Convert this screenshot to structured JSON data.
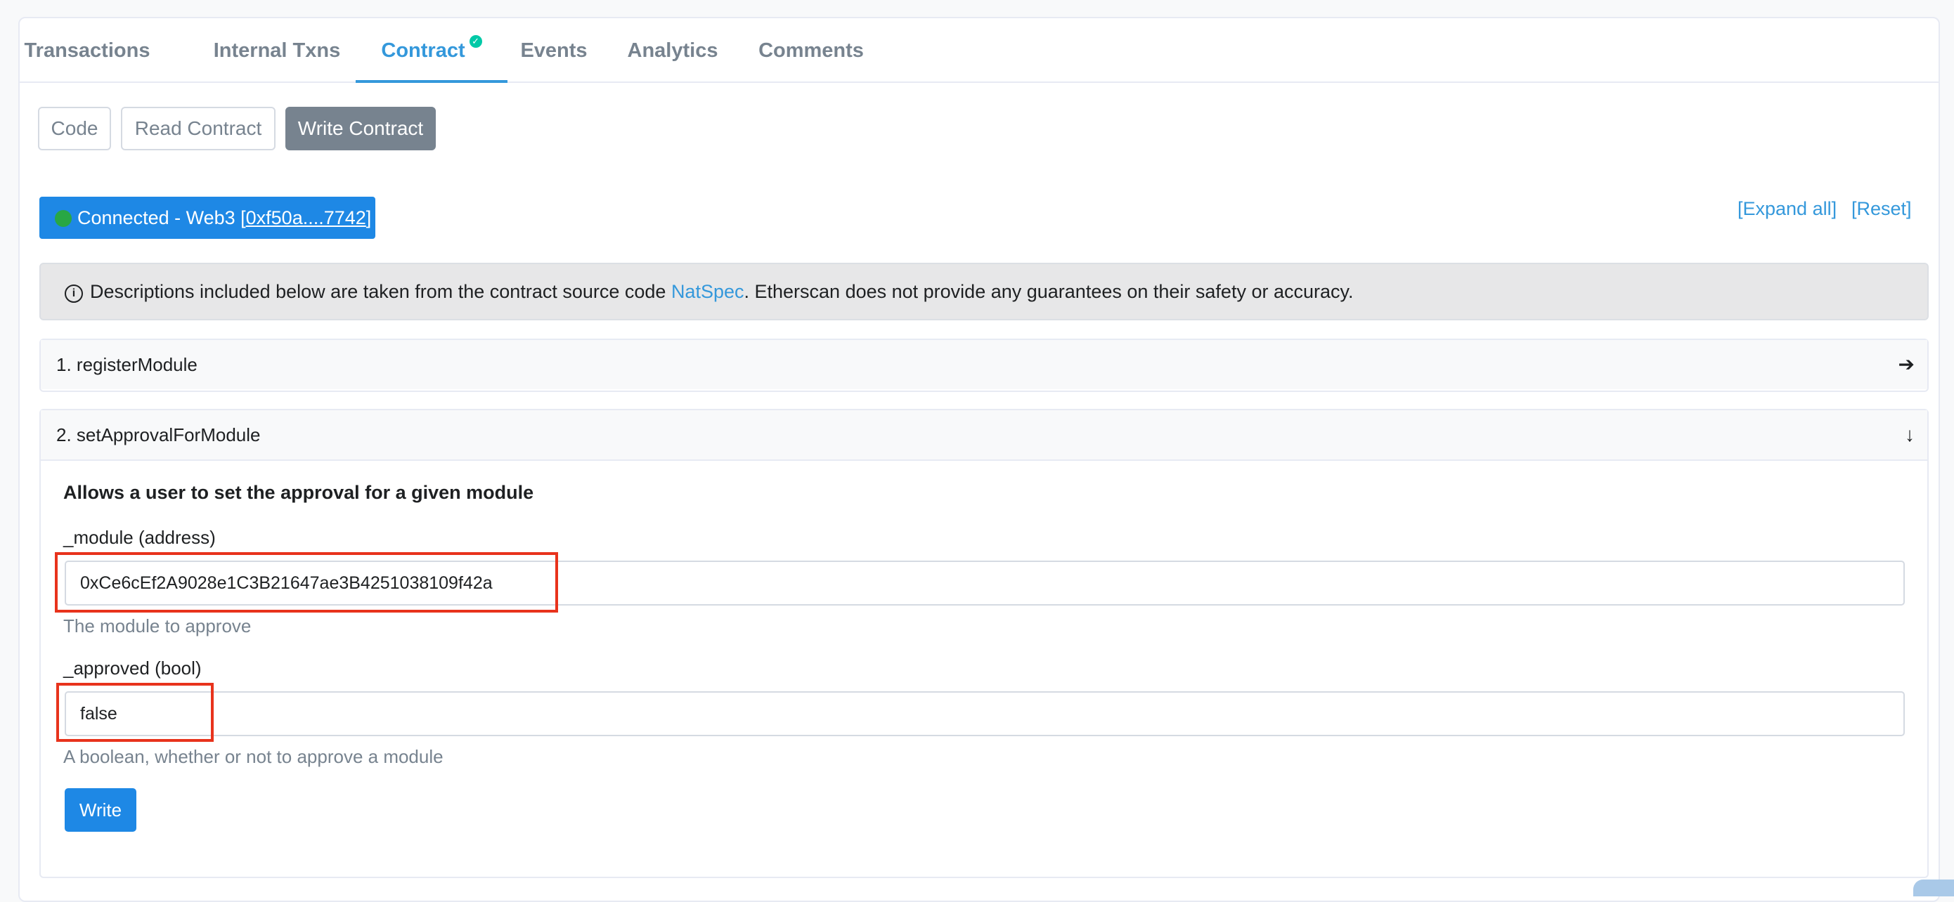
{
  "tabs": [
    {
      "label": "Transactions"
    },
    {
      "label": "Internal Txns"
    },
    {
      "label": "Contract"
    },
    {
      "label": "Events"
    },
    {
      "label": "Analytics"
    },
    {
      "label": "Comments"
    }
  ],
  "subtabs": {
    "code": "Code",
    "read": "Read Contract",
    "write": "Write Contract"
  },
  "connection": {
    "status": "Connected - Web3 [",
    "address": "0xf50a....7742",
    "close": "]"
  },
  "links": {
    "expand_all": "[Expand all]",
    "reset": "[Reset]"
  },
  "notice": {
    "pre": "Descriptions included below are taken from the contract source code ",
    "link": "NatSpec",
    "post": ". Etherscan does not provide any guarantees on their safety or accuracy."
  },
  "functions": [
    {
      "title": "1. registerModule"
    },
    {
      "title": "2. setApprovalForModule",
      "description": "Allows a user to set the approval for a given module",
      "params": [
        {
          "label": "_module (address)",
          "value": "0xCe6cEf2A9028e1C3B21647ae3B4251038109f42a",
          "help": "The module to approve"
        },
        {
          "label": "_approved (bool)",
          "value": "false",
          "help": "A boolean, whether or not to approve a module"
        }
      ],
      "button": "Write"
    }
  ],
  "colors": {
    "accent": "#3498db",
    "button": "#1e88e5",
    "highlight": "#e8331c",
    "connected_dot": "#28a745"
  }
}
